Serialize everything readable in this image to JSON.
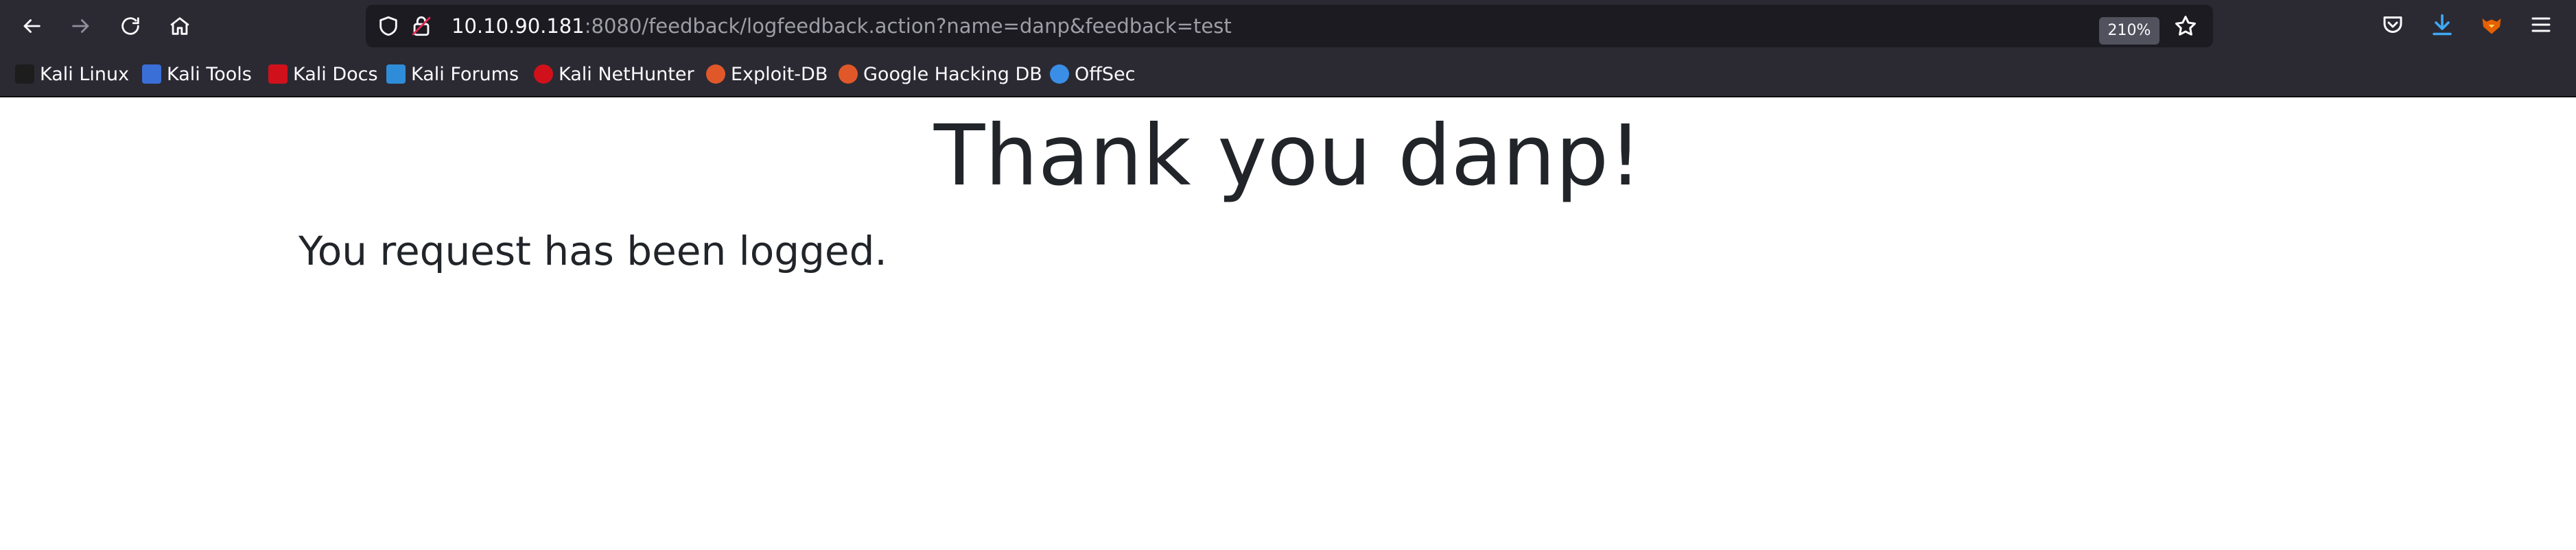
{
  "browser": {
    "url_host": "10.10.90.181",
    "url_rest": ":8080/feedback/logfeedback.action?name=danp&feedback=test",
    "zoom": "210%"
  },
  "bookmarks": [
    {
      "label": "Kali Linux",
      "icon": "kali-dragon-icon",
      "color": "#1d1d1d"
    },
    {
      "label": "Kali Tools",
      "icon": "kali-tools-icon",
      "color": "#3b6fd8"
    },
    {
      "label": "Kali Docs",
      "icon": "kali-docs-icon",
      "color": "#d0111b"
    },
    {
      "label": "Kali Forums",
      "icon": "kali-forums-icon",
      "color": "#2f8cd8"
    },
    {
      "label": "Kali NetHunter",
      "icon": "nethunter-icon",
      "color": "#d0111b"
    },
    {
      "label": "Exploit-DB",
      "icon": "exploit-db-icon",
      "color": "#e0582a"
    },
    {
      "label": "Google Hacking DB",
      "icon": "ghdb-icon",
      "color": "#e0582a"
    },
    {
      "label": "OffSec",
      "icon": "offsec-icon",
      "color": "#3a8ee6"
    }
  ],
  "page": {
    "heading": "Thank you danp!",
    "message": "You request has been logged."
  }
}
